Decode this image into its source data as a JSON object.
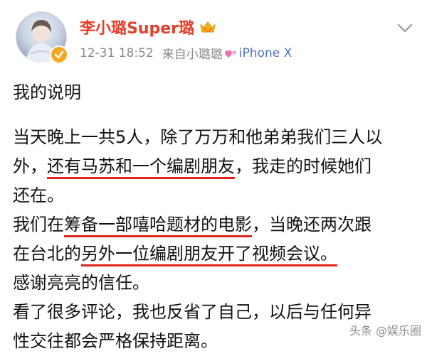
{
  "header": {
    "username": "李小璐Super璐",
    "vip_icon": "crown-badge-icon",
    "verified_icon": "verified-badge-icon",
    "timestamp": "12-31 18:52",
    "source_prefix": "来自",
    "source_name": "小璐璐",
    "source_icon": "pink-hearts-icon",
    "device": "iPhone X",
    "more_icon": "chevron-down-icon"
  },
  "post": {
    "title_line": "我的说明",
    "paragraph1": {
      "line1": "当天晚上一共5人，除了万万和他弟弟我们三人以",
      "line2_a": "外，",
      "line2_b": "还有马苏和一个编剧朋友",
      "line2_c": "，我走的时候她们",
      "line3": "还在。"
    },
    "paragraph2": {
      "line1_a": "我们在",
      "line1_b": "筹备一部嘻哈题材的电影",
      "line1_c": "，当晚还两次跟",
      "line2_a": "在台北的",
      "line2_b": "另外一位编剧朋友开了视频会议。",
      "line3": "感谢亮亮的信任。",
      "line4": "看了很多评论，我也反省了自己，以后与任何异",
      "line5": "性交往都会严格保持距离。"
    }
  },
  "watermark": {
    "text": "头条 @娱乐圈"
  },
  "colors": {
    "username": "#e3402a",
    "meta": "#8a8a8a",
    "device": "#4a72c4",
    "underline": "#e0231b"
  }
}
